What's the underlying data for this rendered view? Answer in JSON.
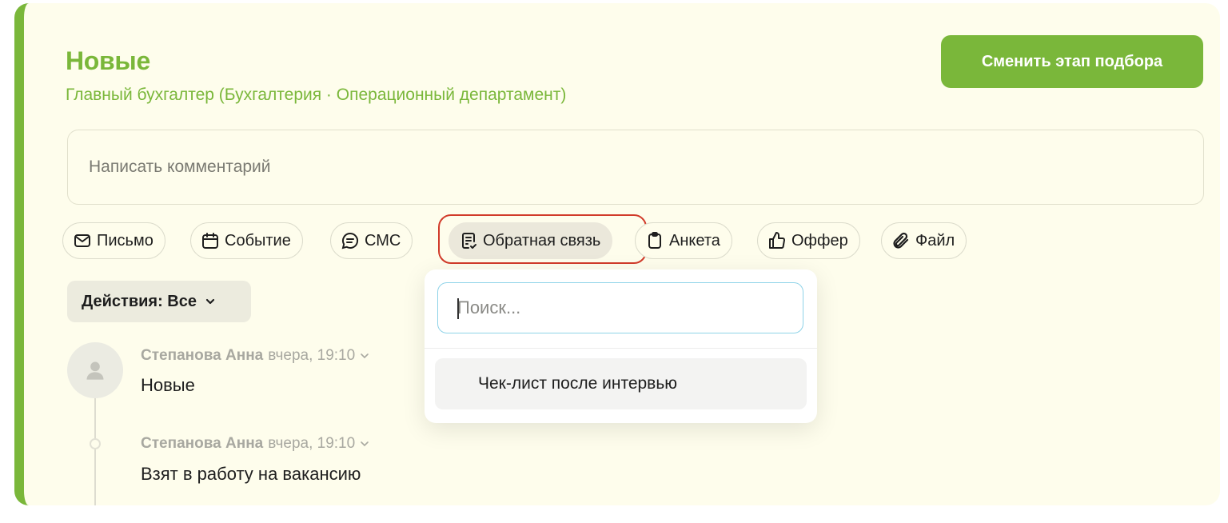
{
  "header": {
    "title": "Новые",
    "subtitle": "Главный бухгалтер (Бухгалтерия · Операционный департамент)",
    "change_stage_label": "Сменить этап подбора"
  },
  "comment": {
    "placeholder": "Написать комментарий"
  },
  "actions": [
    {
      "label": "Письмо",
      "icon": "mail-icon"
    },
    {
      "label": "Событие",
      "icon": "calendar-icon"
    },
    {
      "label": "СМС",
      "icon": "chat-icon"
    },
    {
      "label": "Обратная связь",
      "icon": "feedback-icon",
      "active": true
    },
    {
      "label": "Анкета",
      "icon": "clipboard-icon"
    },
    {
      "label": "Оффер",
      "icon": "thumbs-up-icon"
    },
    {
      "label": "Файл",
      "icon": "paperclip-icon"
    }
  ],
  "filter": {
    "label": "Действия: Все"
  },
  "timeline": [
    {
      "author": "Степанова Анна",
      "time": "вчера, 19:10",
      "text": "Новые"
    },
    {
      "author": "Степанова Анна",
      "time": "вчера, 19:10",
      "text": "Взят в работу на вакансию"
    }
  ],
  "dropdown": {
    "search_placeholder": "Поиск...",
    "options": [
      {
        "label": "Чек-лист после интервью"
      }
    ]
  },
  "colors": {
    "accent": "#7ab73a",
    "card_background": "#fefdec",
    "highlight_border": "#d13b2a",
    "search_focus": "#8fd3e8"
  }
}
